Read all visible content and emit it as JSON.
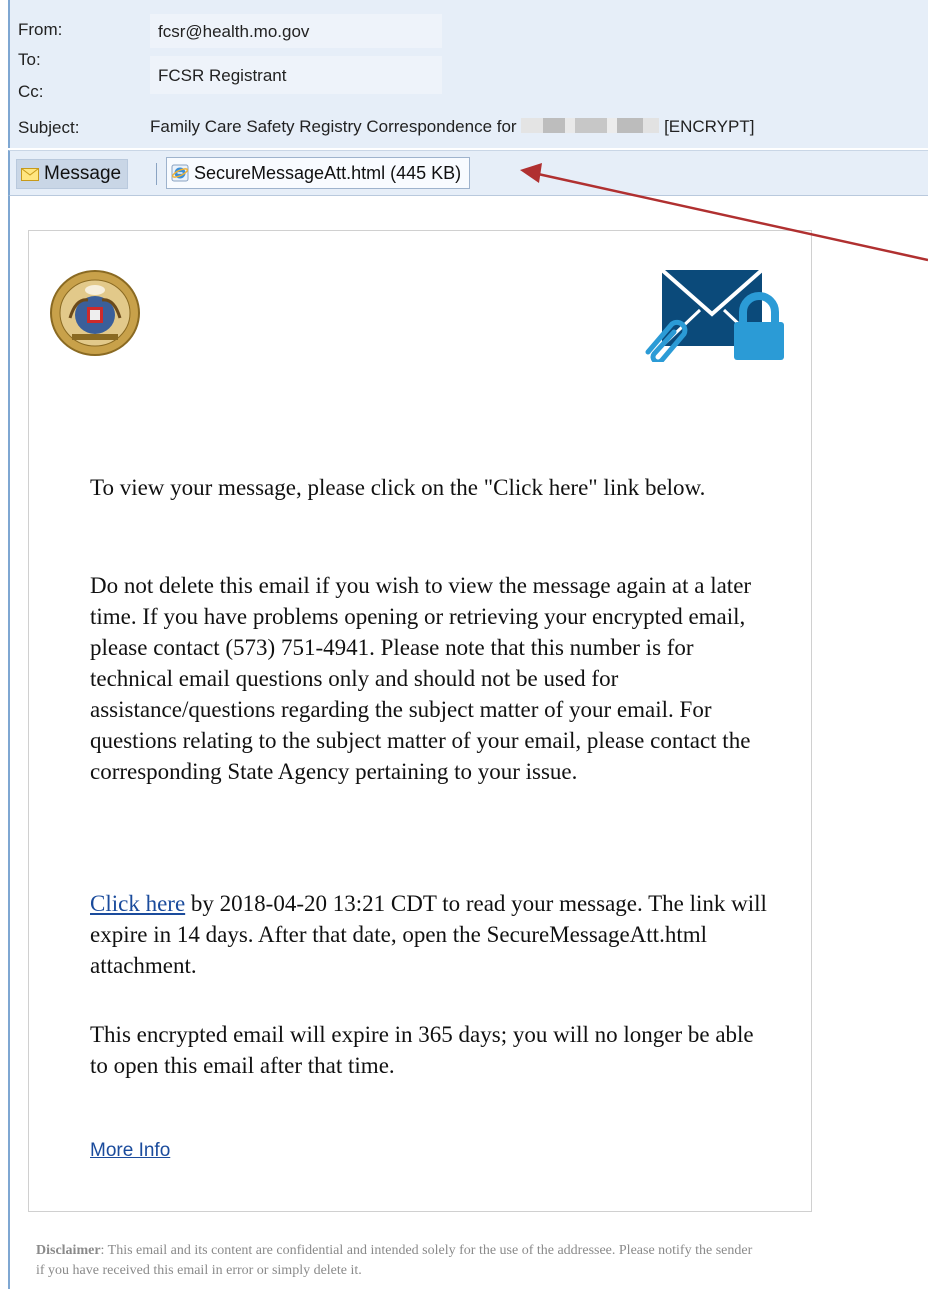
{
  "header": {
    "from_label": "From:",
    "from_value": "fcsr@health.mo.gov",
    "to_label": "To:",
    "to_value": "FCSR Registrant",
    "cc_label": "Cc:",
    "subject_label": "Subject:",
    "subject_prefix": "Family Care Safety Registry Correspondence for",
    "subject_suffix": "[ENCRYPT]"
  },
  "attachments": {
    "message_tab": "Message",
    "attachment_label": "SecureMessageAtt.html (445 KB)"
  },
  "body": {
    "p1": "To view your message, please click on the \"Click here\" link below.",
    "p2": "Do not delete this email if you wish to view the message again at a later time. If you have problems opening or retrieving your encrypted email, please contact (573) 751-4941. Please note that this number is for technical email questions only and should not be used for assistance/questions regarding the subject matter of your email. For questions relating to the subject matter of your email, please contact the corresponding State Agency pertaining to your issue.",
    "click_here": "Click here",
    "p3_rest": " by 2018-04-20 13:21 CDT to read your message. The link will expire in 14 days. After that date, open the SecureMessageAtt.html attachment.",
    "p4": "This encrypted email will expire in 365 days; you will no longer be able to open this email after that time.",
    "more_info": "More Info"
  },
  "disclaimer": {
    "label": "Disclaimer",
    "text": ": This email and its content are confidential and intended solely for the use of the addressee. Please notify the sender if you have received this email in error or simply delete it."
  },
  "colors": {
    "header_bg": "#e6eef8",
    "link": "#1a4b9c",
    "arrow": "#b03030",
    "icon_blue": "#2b9bd6",
    "icon_navy": "#0b4a7a"
  }
}
